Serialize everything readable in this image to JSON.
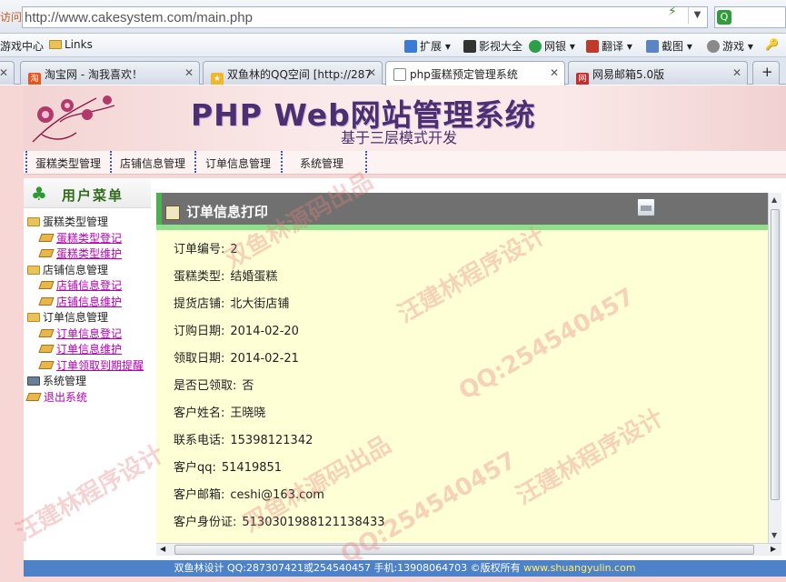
{
  "browser": {
    "address_prefix": "访问",
    "url": "http://www.cakesystem.com/main.php",
    "bookmarks": [
      "游戏中心",
      "Links"
    ],
    "toolbar": [
      "扩展",
      "影视大全",
      "网银",
      "翻译",
      "截图",
      "游戏"
    ],
    "tabs": [
      {
        "label": "淘宝网 - 淘我喜欢！",
        "active": false
      },
      {
        "label": "双鱼林的QQ空间 [http://287",
        "active": false
      },
      {
        "label": "php蛋糕预定管理系统",
        "active": true
      },
      {
        "label": "网易邮箱5.0版",
        "active": false
      }
    ]
  },
  "site": {
    "title": "PHP Web网站管理系统",
    "subtitle": "基于三层模式开发",
    "nav": [
      "蛋糕类型管理",
      "店铺信息管理",
      "订单信息管理",
      "系统管理"
    ]
  },
  "sidebar": {
    "header": "用户菜单",
    "tree": [
      {
        "label": "蛋糕类型管理",
        "children": [
          "蛋糕类型登记",
          "蛋糕类型维护"
        ]
      },
      {
        "label": "店铺信息管理",
        "children": [
          "店铺信息登记",
          "店铺信息维护"
        ]
      },
      {
        "label": "订单信息管理",
        "children": [
          "订单信息登记",
          "订单信息维护",
          "订单领取到期提醒"
        ]
      },
      {
        "label": "系统管理",
        "children": []
      }
    ],
    "exit": "退出系统"
  },
  "main": {
    "heading": "订单信息打印",
    "fields": [
      {
        "label": "订单编号:",
        "value": "2"
      },
      {
        "label": "蛋糕类型:",
        "value": "结婚蛋糕"
      },
      {
        "label": "提货店铺:",
        "value": "北大街店铺"
      },
      {
        "label": "订购日期:",
        "value": "2014-02-20"
      },
      {
        "label": "领取日期:",
        "value": "2014-02-21"
      },
      {
        "label": "是否已领取:",
        "value": "否"
      },
      {
        "label": "客户姓名:",
        "value": "王晓晓"
      },
      {
        "label": "联系电话:",
        "value": "15398121342"
      },
      {
        "label": "客户qq:",
        "value": "51419851"
      },
      {
        "label": "客户邮箱:",
        "value": "ceshi@163.com"
      },
      {
        "label": "客户身份证:",
        "value": "513030198812113843​3"
      }
    ]
  },
  "footer": {
    "text": "双鱼林设计 QQ:287307421或254540457 手机:13908064703 ©版权所有",
    "link": "www.shuangyulin.com"
  },
  "watermarks": [
    "汪建林程序设计",
    "QQ:254540457",
    "双鱼林源码出品"
  ]
}
